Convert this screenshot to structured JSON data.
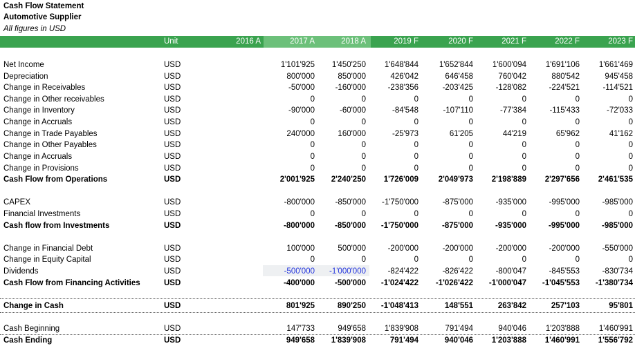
{
  "header": {
    "title": "Cash Flow Statement",
    "subtitle": "Automotive Supplier",
    "note": "All figures in USD"
  },
  "colors": {
    "header_bg": "#3aa34f",
    "actual_header_bg": "#6cc07a",
    "input_blue": "#2233dd"
  },
  "columns": {
    "unit": "Unit",
    "years": [
      "2016 A",
      "2017 A",
      "2018 A",
      "2019 F",
      "2020 F",
      "2021 F",
      "2022 F",
      "2023 F"
    ]
  },
  "rows": [
    {
      "label": "Net Income",
      "unit": "USD",
      "values": [
        "",
        "1'101'925",
        "1'450'250",
        "1'648'844",
        "1'652'844",
        "1'600'094",
        "1'691'106",
        "1'661'469"
      ]
    },
    {
      "label": "Depreciation",
      "unit": "USD",
      "values": [
        "",
        "800'000",
        "850'000",
        "426'042",
        "646'458",
        "760'042",
        "880'542",
        "945'458"
      ]
    },
    {
      "label": "Change in Receivables",
      "unit": "USD",
      "values": [
        "",
        "-50'000",
        "-160'000",
        "-238'356",
        "-203'425",
        "-128'082",
        "-224'521",
        "-114'521"
      ]
    },
    {
      "label": "Change in Other receivables",
      "unit": "USD",
      "values": [
        "",
        "0",
        "0",
        "0",
        "0",
        "0",
        "0",
        "0"
      ]
    },
    {
      "label": "Change in Inventory",
      "unit": "USD",
      "values": [
        "",
        "-90'000",
        "-60'000",
        "-84'548",
        "-107'110",
        "-77'384",
        "-115'433",
        "-72'033"
      ]
    },
    {
      "label": "Change in Accruals",
      "unit": "USD",
      "values": [
        "",
        "0",
        "0",
        "0",
        "0",
        "0",
        "0",
        "0"
      ]
    },
    {
      "label": "Change in Trade Payables",
      "unit": "USD",
      "values": [
        "",
        "240'000",
        "160'000",
        "-25'973",
        "61'205",
        "44'219",
        "65'962",
        "41'162"
      ]
    },
    {
      "label": "Change in Other Payables",
      "unit": "USD",
      "values": [
        "",
        "0",
        "0",
        "0",
        "0",
        "0",
        "0",
        "0"
      ]
    },
    {
      "label": "Change in Accruals",
      "unit": "USD",
      "values": [
        "",
        "0",
        "0",
        "0",
        "0",
        "0",
        "0",
        "0"
      ]
    },
    {
      "label": "Change in Provisions",
      "unit": "USD",
      "values": [
        "",
        "0",
        "0",
        "0",
        "0",
        "0",
        "0",
        "0"
      ]
    },
    {
      "label": "Cash Flow from Operations",
      "unit": "USD",
      "values": [
        "",
        "2'001'925",
        "2'240'250",
        "1'726'009",
        "2'049'973",
        "2'198'889",
        "2'297'656",
        "2'461'535"
      ]
    },
    {
      "label": "CAPEX",
      "unit": "USD",
      "values": [
        "",
        "-800'000",
        "-850'000",
        "-1'750'000",
        "-875'000",
        "-935'000",
        "-995'000",
        "-985'000"
      ]
    },
    {
      "label": "Financial Investments",
      "unit": "USD",
      "values": [
        "",
        "0",
        "0",
        "0",
        "0",
        "0",
        "0",
        "0"
      ]
    },
    {
      "label": "Cash flow from Investments",
      "unit": "USD",
      "values": [
        "",
        "-800'000",
        "-850'000",
        "-1'750'000",
        "-875'000",
        "-935'000",
        "-995'000",
        "-985'000"
      ]
    },
    {
      "label": "Change in Financial Debt",
      "unit": "USD",
      "values": [
        "",
        "100'000",
        "500'000",
        "-200'000",
        "-200'000",
        "-200'000",
        "-200'000",
        "-550'000"
      ]
    },
    {
      "label": "Change in Equity Capital",
      "unit": "USD",
      "values": [
        "",
        "0",
        "0",
        "0",
        "0",
        "0",
        "0",
        "0"
      ]
    },
    {
      "label": "Dividends",
      "unit": "USD",
      "values": [
        "",
        "-500'000",
        "-1'000'000",
        "-824'422",
        "-826'422",
        "-800'047",
        "-845'553",
        "-830'734"
      ]
    },
    {
      "label": "Cash Flow from Financing Activities",
      "unit": "USD",
      "values": [
        "",
        "-400'000",
        "-500'000",
        "-1'024'422",
        "-1'026'422",
        "-1'000'047",
        "-1'045'553",
        "-1'380'734"
      ]
    },
    {
      "label": "Change in Cash",
      "unit": "USD",
      "values": [
        "",
        "801'925",
        "890'250",
        "-1'048'413",
        "148'551",
        "263'842",
        "257'103",
        "95'801"
      ]
    },
    {
      "label": "Cash Beginning",
      "unit": "USD",
      "values": [
        "",
        "147'733",
        "949'658",
        "1'839'908",
        "791'494",
        "940'046",
        "1'203'888",
        "1'460'991"
      ]
    },
    {
      "label": "Cash Ending",
      "unit": "USD",
      "values": [
        "",
        "949'658",
        "1'839'908",
        "791'494",
        "940'046",
        "1'203'888",
        "1'460'991",
        "1'556'792"
      ]
    }
  ]
}
